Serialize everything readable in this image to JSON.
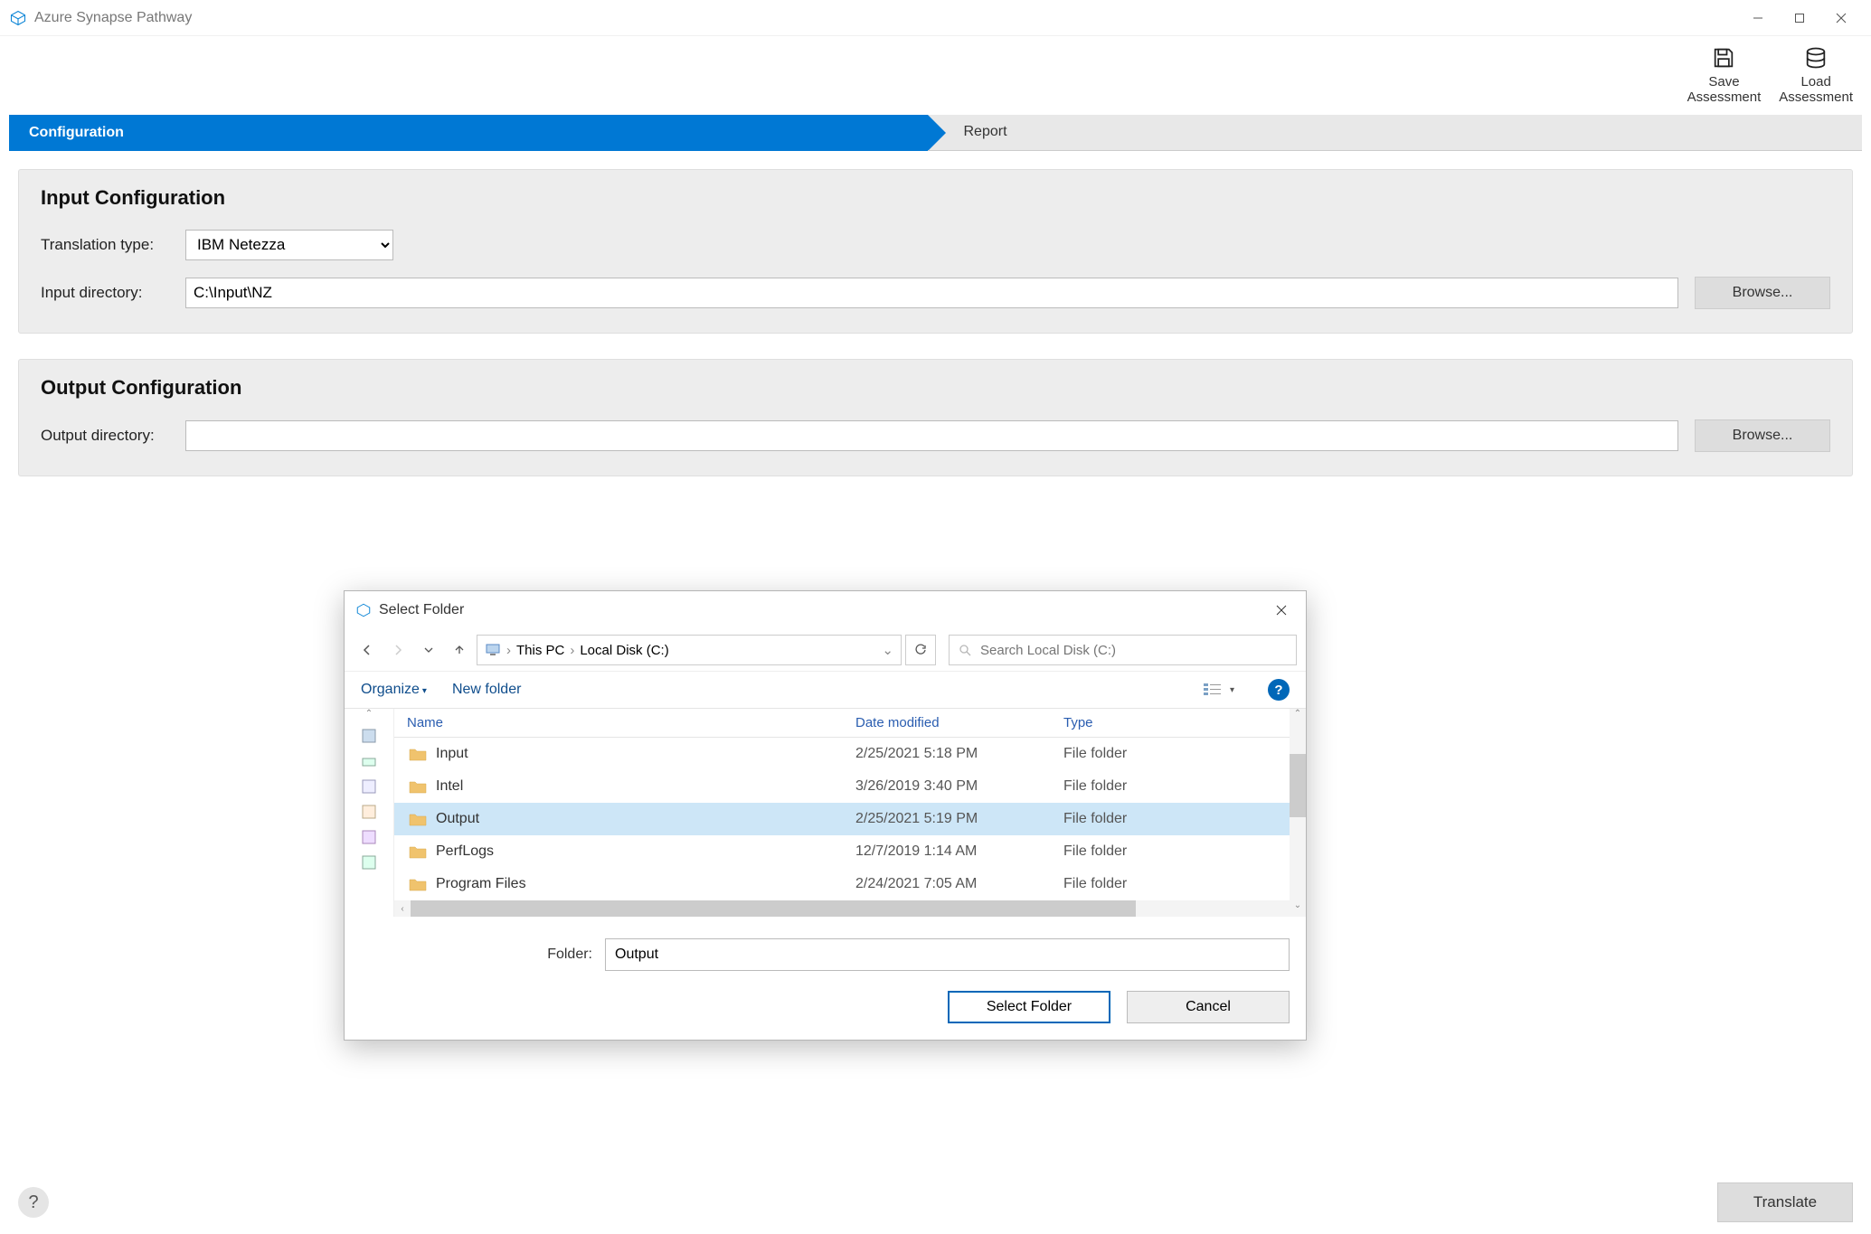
{
  "window": {
    "title": "Azure Synapse Pathway"
  },
  "toolbar": {
    "save_label": "Save Assessment",
    "load_label": "Load Assessment"
  },
  "tabs": {
    "config": "Configuration",
    "report": "Report"
  },
  "input_panel": {
    "heading": "Input Configuration",
    "translation_label": "Translation type:",
    "translation_value": "IBM Netezza",
    "directory_label": "Input directory:",
    "directory_value": "C:\\Input\\NZ",
    "browse": "Browse..."
  },
  "output_panel": {
    "heading": "Output Configuration",
    "directory_label": "Output directory:",
    "directory_value": "",
    "browse": "Browse..."
  },
  "dialog": {
    "title": "Select Folder",
    "breadcrumb": {
      "root": "This PC",
      "leaf": "Local Disk (C:)"
    },
    "search_placeholder": "Search Local Disk (C:)",
    "organize": "Organize",
    "new_folder": "New folder",
    "columns": {
      "name": "Name",
      "date": "Date modified",
      "type": "Type"
    },
    "rows": [
      {
        "name": "Input",
        "date": "2/25/2021 5:18 PM",
        "type": "File folder",
        "selected": false
      },
      {
        "name": "Intel",
        "date": "3/26/2019 3:40 PM",
        "type": "File folder",
        "selected": false
      },
      {
        "name": "Output",
        "date": "2/25/2021 5:19 PM",
        "type": "File folder",
        "selected": true
      },
      {
        "name": "PerfLogs",
        "date": "12/7/2019 1:14 AM",
        "type": "File folder",
        "selected": false
      },
      {
        "name": "Program Files",
        "date": "2/24/2021 7:05 AM",
        "type": "File folder",
        "selected": false
      }
    ],
    "folder_label": "Folder:",
    "folder_value": "Output",
    "select_btn": "Select Folder",
    "cancel_btn": "Cancel"
  },
  "footer": {
    "help": "?",
    "translate": "Translate"
  }
}
